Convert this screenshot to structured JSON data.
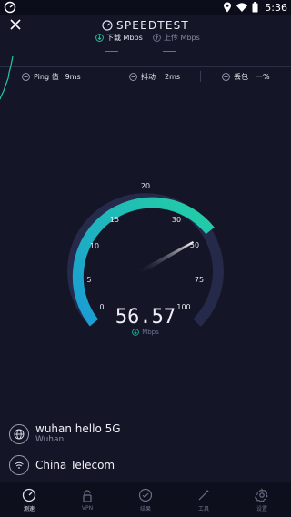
{
  "status_bar": {
    "time": "5:36"
  },
  "header": {
    "title": "SPEEDTEST",
    "download_label": "下载 Mbps",
    "upload_label": "上传 Mbps"
  },
  "info_bar": {
    "ping_label": "Ping 值",
    "ping_value": "9ms",
    "jitter_label": "抖动",
    "jitter_value": "2ms",
    "loss_label": "丢包",
    "loss_value": "一%"
  },
  "gauge": {
    "ticks": [
      "0",
      "5",
      "10",
      "15",
      "20",
      "30",
      "50",
      "75",
      "100"
    ],
    "value": "56.57",
    "unit": "Mbps"
  },
  "server": {
    "name": "wuhan hello 5G",
    "location": "Wuhan"
  },
  "provider": {
    "name": "China Telecom"
  },
  "bottom_nav": [
    {
      "label": "测速"
    },
    {
      "label": "VPN"
    },
    {
      "label": "结果"
    },
    {
      "label": "工具"
    },
    {
      "label": "设置"
    }
  ],
  "colors": {
    "background": "#141526",
    "gauge_arc_start": "#1aa0d8",
    "gauge_arc_end": "#23d0a6",
    "gauge_track": "#25294a"
  }
}
